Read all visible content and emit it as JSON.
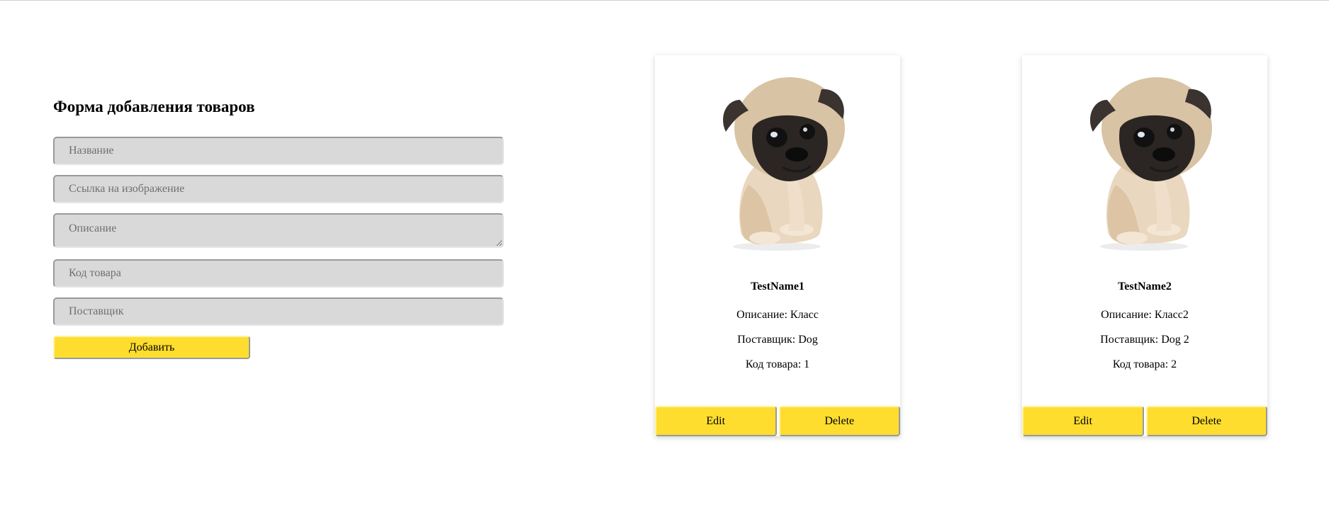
{
  "form": {
    "title": "Форма добавления товаров",
    "name_placeholder": "Название",
    "image_placeholder": "Ссылка на изображение",
    "description_placeholder": "Описание",
    "code_placeholder": "Код товара",
    "supplier_placeholder": "Поставщик",
    "submit_label": "Добавить"
  },
  "products": [
    {
      "name": "TestName1",
      "description": "Описание: Класс",
      "supplier": "Поставщик: Dog",
      "code": "Код товара: 1",
      "edit_label": "Edit",
      "delete_label": "Delete",
      "image": "pug-puppy-photo"
    },
    {
      "name": "TestName2",
      "description": "Описание: Класс2",
      "supplier": "Поставщик: Dog 2",
      "code": "Код товара: 2",
      "edit_label": "Edit",
      "delete_label": "Delete",
      "image": "pug-puppy-photo"
    }
  ],
  "colors": {
    "accent": "#fedd2e",
    "input_bg": "#d9d9d9"
  }
}
